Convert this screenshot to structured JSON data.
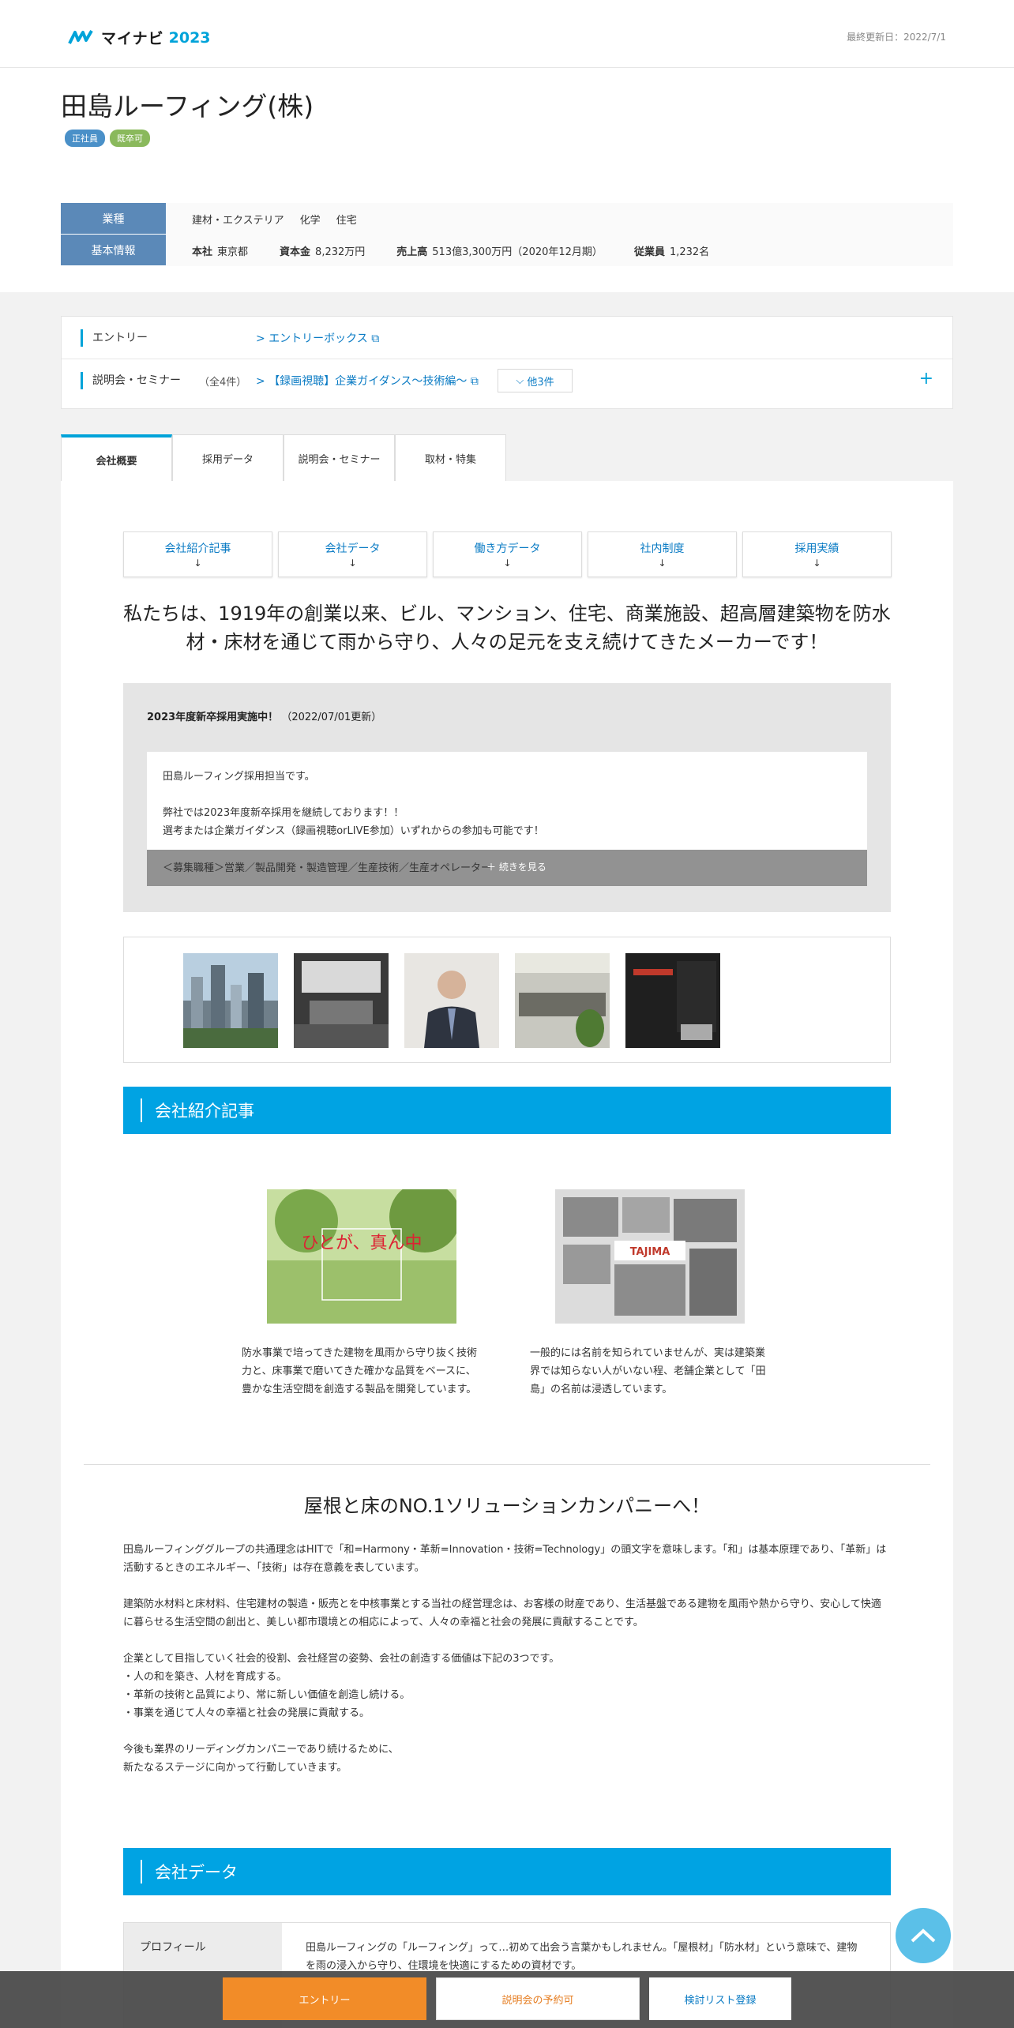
{
  "header": {
    "logo_text": "マイナビ",
    "logo_year": "2023",
    "updated": "最終更新日：2022/7/1"
  },
  "company": {
    "name": "田島ルーフィング(株)",
    "tags": [
      "正社員",
      "既卒可"
    ]
  },
  "info": {
    "industry_label": "業種",
    "industry_values": [
      "建材・エクステリア",
      "化学",
      "住宅"
    ],
    "basic_label": "基本情報",
    "basic": [
      {
        "k": "本社",
        "v": "東京都"
      },
      {
        "k": "資本金",
        "v": "8,232万円"
      },
      {
        "k": "売上高",
        "v": "513億3,300万円（2020年12月期）"
      },
      {
        "k": "従業員",
        "v": "1,232名"
      }
    ]
  },
  "entry": {
    "entry_label": "エントリー",
    "entry_link": "エントリーボックス",
    "seminar_label": "説明会・セミナー",
    "seminar_count": "（全4件）",
    "seminar_link": "【録画視聴】企業ガイダンス～技術編～",
    "others": "他3件",
    "plus": "+"
  },
  "tabs": [
    "会社概要",
    "採用データ",
    "説明会・セミナー",
    "取材・特集"
  ],
  "anchors": [
    "会社紹介記事",
    "会社データ",
    "働き方データ",
    "社内制度",
    "採用実績"
  ],
  "anchor_arrow": "↓",
  "catch": "私たちは、1919年の創業以来、ビル、マンション、住宅、商業施設、超高層建築物を防水材・床材を通じて雨から守り、人々の足元を支え続けてきたメーカーです！",
  "news": {
    "title": "2023年度新卒採用実施中！",
    "date": "（2022/07/01更新）",
    "lines": [
      "田島ルーフィング採用担当です。",
      "",
      "弊社では2023年度新卒採用を継続しております！！",
      "選考または企業ガイダンス（録画視聴orLIVE参加）いずれからの参加も可能です！"
    ],
    "fade_line": "＜募集職種＞営業／製品開発・製造管理／生産技術／生産オペレーター",
    "more": "＋ 続きを見る"
  },
  "section_intro": "会社紹介記事",
  "articles": [
    {
      "text": "防水事業で培ってきた建物を風雨から守り抜く技術力と、床事業で磨いてきた確かな品質をベースに、豊かな生活空間を創造する製品を開発しています。",
      "img_caption": "ひとが、真ん中"
    },
    {
      "text": "一般的には名前を知られていませんが、実は建築業界では知らない人がいない程、老舗企業として「田島」の名前は浸透しています。",
      "img_caption": "TAJIMA"
    }
  ],
  "h2": "屋根と床のNO.1ソリューションカンパニーへ！",
  "body_paragraphs": [
    "田島ルーフィンググループの共通理念はHITで「和=Harmony・革新=Innovation・技術=Technology」の頭文字を意味します。「和」は基本原理であり、「革新」は活動するときのエネルギー、「技術」は存在意義を表しています。",
    "建築防水材料と床材料、住宅建材の製造・販売とを中核事業とする当社の経営理念は、お客様の財産であり、生活基盤である建物を風雨や熱から守り、安心して快適に暮らせる生活空間の創出と、美しい都市環境との相応によって、人々の幸福と社会の発展に貢献することです。",
    "企業として目指していく社会的役割、会社経営の姿勢、会社の創造する価値は下記の3つです。\n・人の和を築き、人材を育成する。\n・革新の技術と品質により、常に新しい価値を創造し続ける。\n・事業を通じて人々の幸福と社会の発展に貢献する。",
    "今後も業界のリーディングカンパニーであり続けるために、\n新たなるステージに向かって行動していきます。"
  ],
  "section_data": "会社データ",
  "profile": {
    "label": "プロフィール",
    "text": "田島ルーフィングの「ルーフィング」って…初めて出会う言葉かもしれません。「屋根材」「防水材」という意味で、建物を雨の浸入から守り、住環境を快適にするための資材です。"
  },
  "bottom": {
    "entry": "エントリー",
    "seminar": "説明会の予約可",
    "list": "検討リスト登録"
  },
  "colors": {
    "accent": "#00a3e3",
    "entry": "#f28c28",
    "label": "#5b89b8"
  }
}
